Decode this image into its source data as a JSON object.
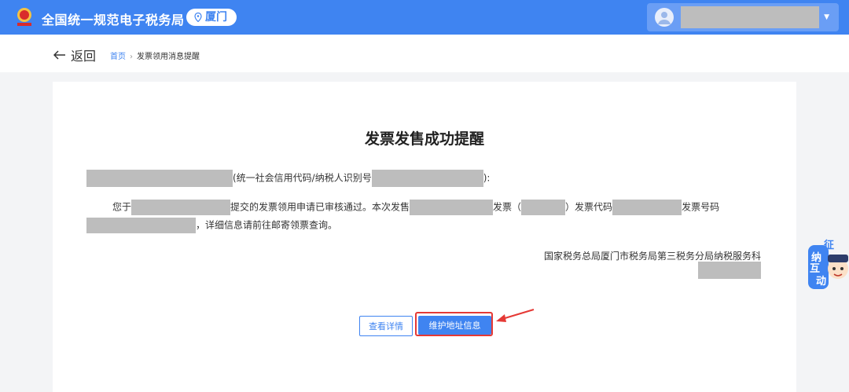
{
  "header": {
    "site_title": "全国统一规范电子税务局",
    "city": "厦门"
  },
  "nav": {
    "back_label": "返回",
    "breadcrumb_home": "首页",
    "breadcrumb_separator": "›",
    "breadcrumb_current": "发票领用消息提醒"
  },
  "notice": {
    "title": "发票发售成功提醒",
    "credit_code_label": "(统一社会信用代码/纳税人识别号",
    "credit_code_end": "):",
    "body_prefix": "您于",
    "body_submitted": "提交的发票领用申请已审核通过。本次发售",
    "body_invoice": "发票（",
    "body_code_label": "）发票代码",
    "body_number_label": "发票号码",
    "body_tail": "，详细信息请前往邮寄领票查询。",
    "signature": "国家税务总局厦门市税务局第三税务分局纳税服务科"
  },
  "actions": {
    "view_details": "查看详情",
    "maintain_address": "维护地址信息"
  },
  "mascot": {
    "chars": [
      "征",
      "纳",
      "互",
      "动"
    ]
  },
  "colors": {
    "primary": "#3f84f1",
    "highlight": "#e53935",
    "redaction": "#bdbdbd"
  }
}
